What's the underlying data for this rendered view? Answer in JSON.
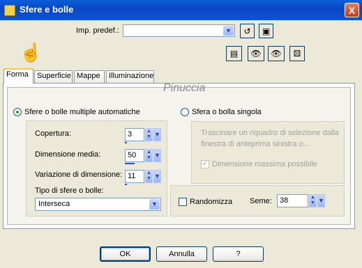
{
  "window": {
    "title": "Sfere e bolle",
    "close_glyph": "X"
  },
  "preset": {
    "label": "Imp. predef.:",
    "value": ""
  },
  "tabs": [
    "Forma",
    "Superficie",
    "Mappe",
    "Illuminazione"
  ],
  "watermark": "Pinuccia",
  "auto": {
    "radio_label": "Sfere o bolle multiple automatiche",
    "copertura_label": "Copertura:",
    "copertura_value": "3",
    "copertura_level": 0.03,
    "dimensione_label": "Dimensione media:",
    "dimensione_value": "50",
    "dimensione_level": 0.5,
    "variazione_label": "Variazione di dimensione:",
    "variazione_value": "11",
    "variazione_level": 0.11,
    "tipo_label": "Tipo di sfere o bolle:",
    "tipo_value": "Interseca"
  },
  "single": {
    "radio_label": "Sfera o bolla singola",
    "hint": "Trascinare un riquadro di selezione dalla finestra di anteprima sinistra o...",
    "max_label": "Dimensione massima possibile"
  },
  "random": {
    "label": "Randomizza",
    "seed_label": "Seme:",
    "seed_value": "38"
  },
  "buttons": {
    "ok": "OK",
    "cancel": "Annulla",
    "help": "?"
  }
}
